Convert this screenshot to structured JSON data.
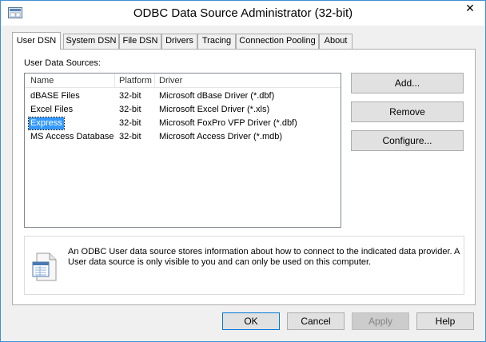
{
  "window": {
    "title": "ODBC Data Source Administrator (32-bit)",
    "close_glyph": "✕"
  },
  "tabs": [
    {
      "label": "User DSN",
      "active": true
    },
    {
      "label": "System DSN"
    },
    {
      "label": "File DSN"
    },
    {
      "label": "Drivers"
    },
    {
      "label": "Tracing"
    },
    {
      "label": "Connection Pooling"
    },
    {
      "label": "About"
    }
  ],
  "user_dsn": {
    "section_label": "User Data Sources:",
    "columns": [
      "Name",
      "Platform",
      "Driver"
    ],
    "rows": [
      {
        "name": "dBASE Files",
        "platform": "32-bit",
        "driver": "Microsoft dBase Driver (*.dbf)"
      },
      {
        "name": "Excel Files",
        "platform": "32-bit",
        "driver": "Microsoft Excel Driver (*.xls)"
      },
      {
        "name": "Express",
        "platform": "32-bit",
        "driver": "Microsoft FoxPro VFP Driver (*.dbf)",
        "selected": true
      },
      {
        "name": "MS Access Database",
        "platform": "32-bit",
        "driver": "Microsoft Access Driver (*.mdb)"
      }
    ],
    "side_buttons": {
      "add": "Add...",
      "remove": "Remove",
      "configure": "Configure..."
    },
    "info_text": "An ODBC User data source stores information about how to connect to the indicated data provider.   A User data source is only visible to you and can only be used on this computer."
  },
  "footer": {
    "ok": "OK",
    "cancel": "Cancel",
    "apply": "Apply",
    "help": "Help"
  },
  "colors": {
    "selection": "#3399ff",
    "window_border": "#3f8fd3",
    "dialog_bg": "#f0f0f0"
  },
  "icons": {
    "app": "odbc-app-icon",
    "info": "data-source-info-icon"
  }
}
